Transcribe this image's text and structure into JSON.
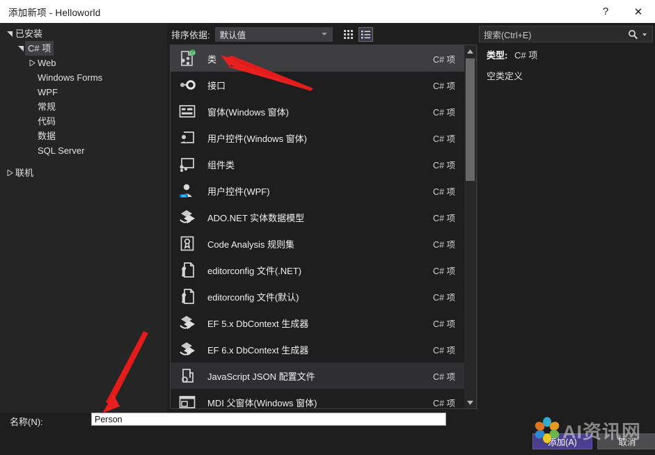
{
  "window": {
    "title": "添加新项 - Helloworld",
    "help_label": "?",
    "close_label": "✕"
  },
  "tree": {
    "nodes": [
      {
        "label": "已安装",
        "level": 0,
        "expanded": true,
        "twisty": "chevron-down-icon",
        "selected": false
      },
      {
        "label": "C# 项",
        "level": 1,
        "expanded": true,
        "twisty": "chevron-down-icon",
        "selected": true
      },
      {
        "label": "Web",
        "level": 2,
        "expanded": false,
        "twisty": "chevron-right-icon",
        "selected": false
      },
      {
        "label": "Windows Forms",
        "level": 2,
        "expanded": null,
        "twisty": "none",
        "selected": false
      },
      {
        "label": "WPF",
        "level": 2,
        "expanded": null,
        "twisty": "none",
        "selected": false
      },
      {
        "label": "常规",
        "level": 2,
        "expanded": null,
        "twisty": "none",
        "selected": false
      },
      {
        "label": "代码",
        "level": 2,
        "expanded": null,
        "twisty": "none",
        "selected": false
      },
      {
        "label": "数据",
        "level": 2,
        "expanded": null,
        "twisty": "none",
        "selected": false
      },
      {
        "label": "SQL Server",
        "level": 2,
        "expanded": null,
        "twisty": "none",
        "selected": false
      },
      {
        "label": "联机",
        "level": 0,
        "expanded": false,
        "twisty": "chevron-right-icon",
        "selected": false
      }
    ]
  },
  "toolbar": {
    "sort_label": "排序依据:",
    "sort_value": "默认值",
    "sort_options": [
      "默认值"
    ],
    "grid_view_icon": "grid-view-icon",
    "list_view_icon": "list-view-icon",
    "active_view": "list"
  },
  "list": {
    "type_column_value": "C# 项",
    "items": [
      {
        "name": "类",
        "type": "C# 项",
        "icon": "class-icon",
        "state": "selected"
      },
      {
        "name": "接口",
        "type": "C# 项",
        "icon": "interface-icon",
        "state": "normal"
      },
      {
        "name": "窗体(Windows 窗体)",
        "type": "C# 项",
        "icon": "form-icon",
        "state": "normal"
      },
      {
        "name": "用户控件(Windows 窗体)",
        "type": "C# 项",
        "icon": "user-control-icon",
        "state": "normal"
      },
      {
        "name": "组件类",
        "type": "C# 项",
        "icon": "component-class-icon",
        "state": "normal"
      },
      {
        "name": "用户控件(WPF)",
        "type": "C# 项",
        "icon": "wpf-user-control-icon",
        "state": "normal"
      },
      {
        "name": "ADO.NET 实体数据模型",
        "type": "C# 项",
        "icon": "entity-model-icon",
        "state": "normal"
      },
      {
        "name": "Code Analysis 规则集",
        "type": "C# 项",
        "icon": "ruleset-icon",
        "state": "normal"
      },
      {
        "name": "editorconfig 文件(.NET)",
        "type": "C# 项",
        "icon": "editorconfig-icon",
        "state": "normal"
      },
      {
        "name": "editorconfig 文件(默认)",
        "type": "C# 项",
        "icon": "editorconfig-icon",
        "state": "normal"
      },
      {
        "name": "EF 5.x DbContext 生成器",
        "type": "C# 项",
        "icon": "dbcontext-icon",
        "state": "normal"
      },
      {
        "name": "EF 6.x DbContext 生成器",
        "type": "C# 项",
        "icon": "dbcontext-icon",
        "state": "normal"
      },
      {
        "name": "JavaScript JSON 配置文件",
        "type": "C# 项",
        "icon": "json-config-icon",
        "state": "hover"
      },
      {
        "name": "MDI 父窗体(Windows 窗体)",
        "type": "C# 项",
        "icon": "mdi-parent-form-icon",
        "state": "normal"
      }
    ]
  },
  "search": {
    "placeholder": "搜索(Ctrl+E)",
    "value": "",
    "icon": "search-icon"
  },
  "details": {
    "type_label": "类型:",
    "type_value": "C# 项",
    "description": "空类定义"
  },
  "footer": {
    "name_label": "名称(N):",
    "name_value": "Person",
    "add_button": "添加(A)",
    "add_button_prefix": "添加(",
    "add_button_key": "A",
    "add_button_suffix": ")",
    "cancel_button": "取消"
  },
  "watermark": {
    "text": "AI资讯网",
    "logo_icon": "flower-logo-icon"
  },
  "colors": {
    "accent": "#4a3f8f",
    "selection": "#3e3e40",
    "panel": "#1e1e1f",
    "sidebar": "#252526",
    "titlebar": "#ffffff",
    "annotation": "#e21b1b"
  },
  "annotations": [
    {
      "name": "arrow-to-class-item",
      "color": "#e21b1b"
    },
    {
      "name": "arrow-to-name-field",
      "color": "#e21b1b"
    }
  ]
}
